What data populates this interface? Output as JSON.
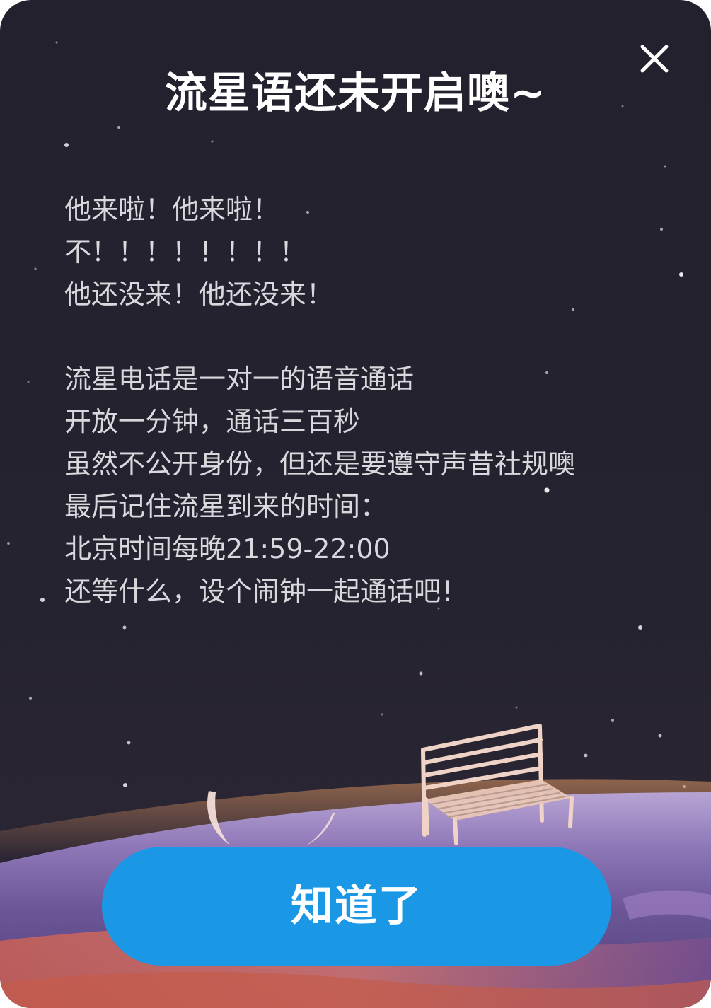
{
  "dialog": {
    "title": "流星语还未开启噢~",
    "close_icon": "close-icon",
    "lines": [
      "他来啦！他来啦！",
      "不！！！！！！！！",
      "他还没来！他还没来！",
      "",
      "流星电话是一对一的语音通话",
      "开放一分钟，通话三百秒",
      "虽然不公开身份，但还是要遵守声昔社规噢",
      "最后记住流星到来的时间：",
      "北京时间每晚21:59-22:00",
      "还等什么，设个闹钟一起通话吧！"
    ],
    "confirm_label": "知道了"
  },
  "colors": {
    "background": "#24212f",
    "button": "#1a98e6",
    "title": "#ffffff",
    "text": "#d9d9dd"
  }
}
